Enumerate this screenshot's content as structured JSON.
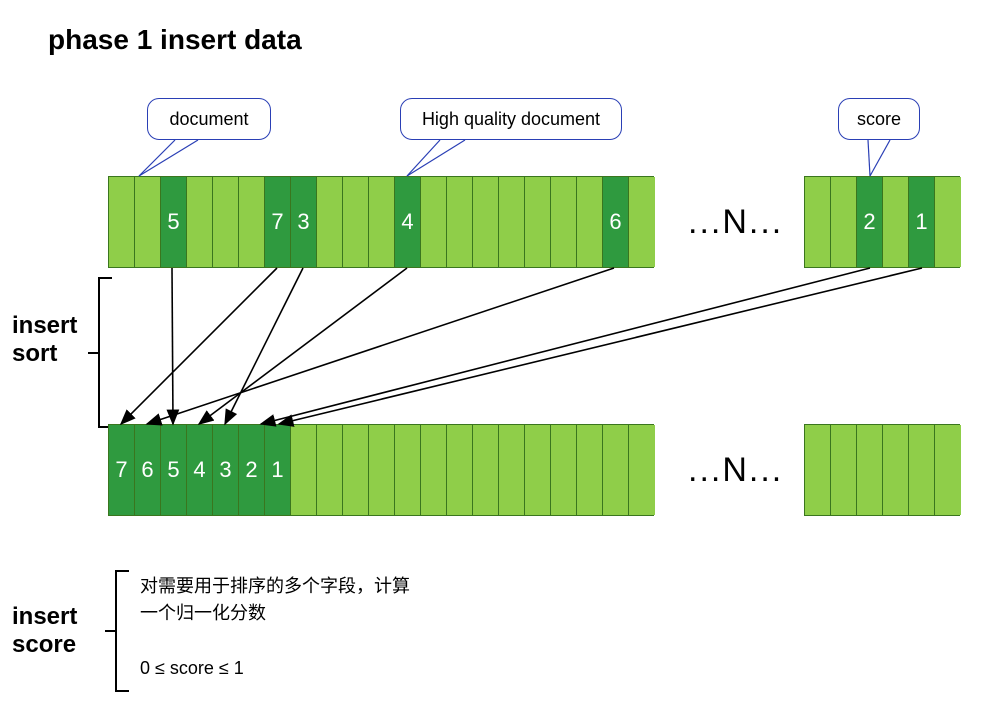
{
  "title": "phase 1 insert data",
  "labels": {
    "insert_sort": "insert\nsort",
    "insert_score": "insert\nscore",
    "ellipsis_n": "...N..."
  },
  "callouts": {
    "document": "document",
    "hq_document": "High quality document",
    "score": "score"
  },
  "top_row": {
    "left_block_cells": [
      {
        "fill": "lg"
      },
      {
        "fill": "lg"
      },
      {
        "fill": "dg",
        "label": "5"
      },
      {
        "fill": "lg"
      },
      {
        "fill": "lg"
      },
      {
        "fill": "lg"
      },
      {
        "fill": "dg",
        "label": "7"
      },
      {
        "fill": "dg",
        "label": "3"
      },
      {
        "fill": "lg"
      },
      {
        "fill": "lg"
      },
      {
        "fill": "lg"
      },
      {
        "fill": "dg",
        "label": "4"
      },
      {
        "fill": "lg"
      },
      {
        "fill": "lg"
      },
      {
        "fill": "lg"
      },
      {
        "fill": "lg"
      },
      {
        "fill": "lg"
      },
      {
        "fill": "lg"
      },
      {
        "fill": "lg"
      },
      {
        "fill": "dg",
        "label": "6"
      },
      {
        "fill": "lg"
      }
    ],
    "right_block_cells": [
      {
        "fill": "lg"
      },
      {
        "fill": "lg"
      },
      {
        "fill": "dg",
        "label": "2"
      },
      {
        "fill": "lg"
      },
      {
        "fill": "dg",
        "label": "1"
      },
      {
        "fill": "lg"
      }
    ]
  },
  "bottom_row": {
    "left_block_cells": [
      {
        "fill": "dg",
        "label": "7"
      },
      {
        "fill": "dg",
        "label": "6"
      },
      {
        "fill": "dg",
        "label": "5"
      },
      {
        "fill": "dg",
        "label": "4"
      },
      {
        "fill": "dg",
        "label": "3"
      },
      {
        "fill": "dg",
        "label": "2"
      },
      {
        "fill": "dg",
        "label": "1"
      },
      {
        "fill": "lg"
      },
      {
        "fill": "lg"
      },
      {
        "fill": "lg"
      },
      {
        "fill": "lg"
      },
      {
        "fill": "lg"
      },
      {
        "fill": "lg"
      },
      {
        "fill": "lg"
      },
      {
        "fill": "lg"
      },
      {
        "fill": "lg"
      },
      {
        "fill": "lg"
      },
      {
        "fill": "lg"
      },
      {
        "fill": "lg"
      },
      {
        "fill": "lg"
      },
      {
        "fill": "lg"
      }
    ],
    "right_block_cells": [
      {
        "fill": "lg"
      },
      {
        "fill": "lg"
      },
      {
        "fill": "lg"
      },
      {
        "fill": "lg"
      },
      {
        "fill": "lg"
      },
      {
        "fill": "lg"
      }
    ]
  },
  "notes": {
    "zh_line1": "对需要用于排序的多个字段，计算",
    "zh_line2": "一个归一化分数",
    "range": "0 ≤  score ≤ 1"
  }
}
